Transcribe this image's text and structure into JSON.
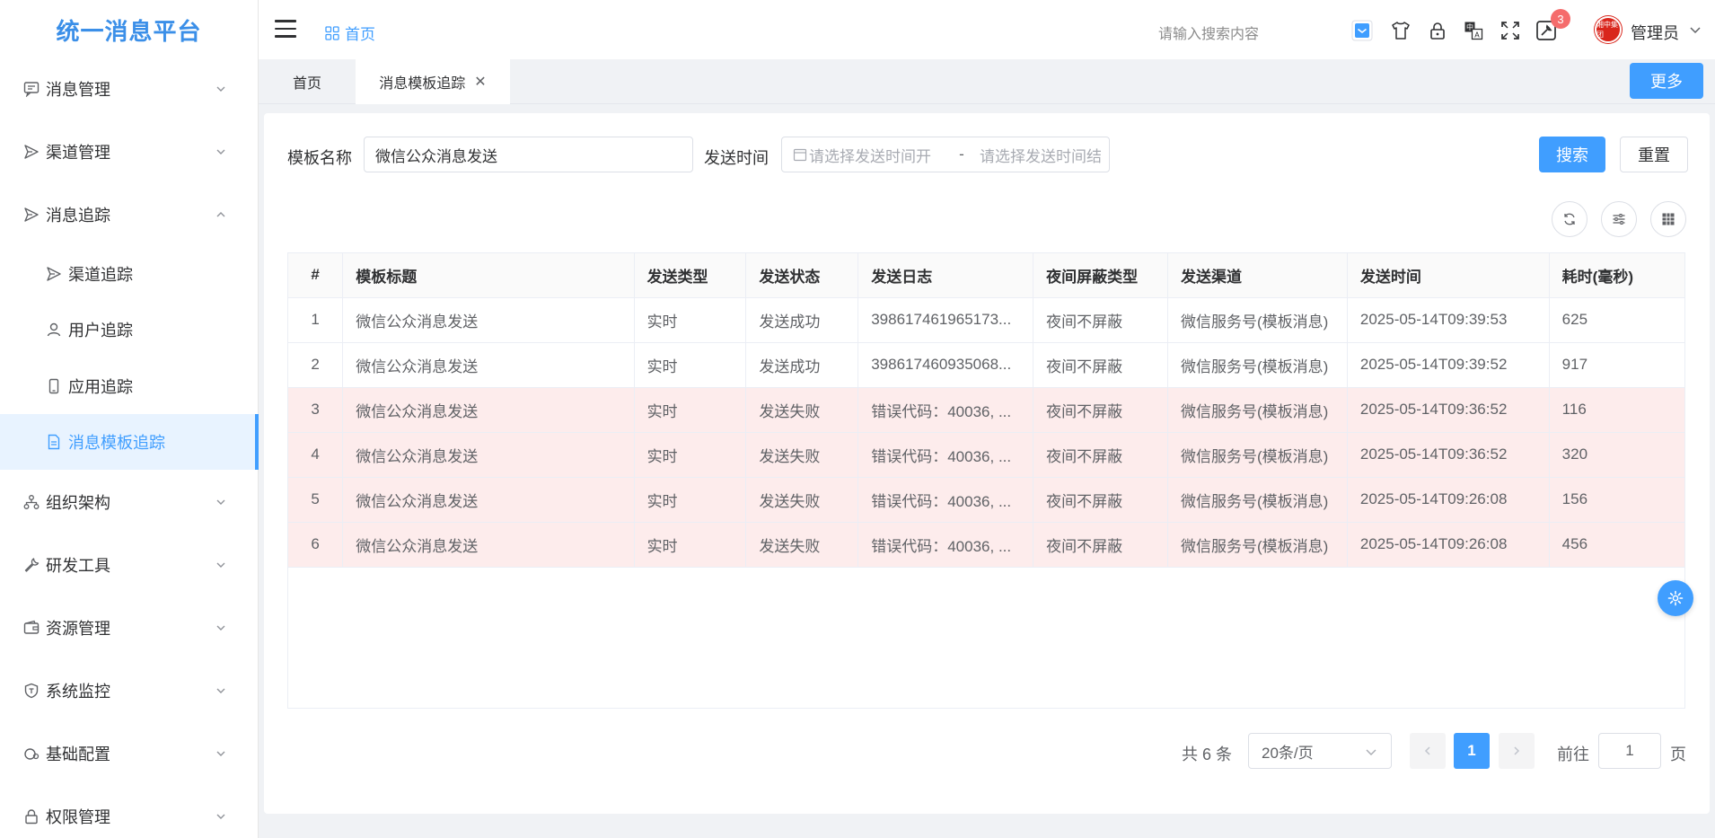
{
  "app": {
    "title": "统一消息平台"
  },
  "header": {
    "home_label": "首页",
    "search_placeholder": "请输入搜索内容",
    "notification_count": "3",
    "avatar_text": "湘中集团",
    "user_name": "管理员"
  },
  "sidebar": {
    "items": [
      {
        "label": "消息管理",
        "icon": "message-icon"
      },
      {
        "label": "渠道管理",
        "icon": "send-icon"
      },
      {
        "label": "消息追踪",
        "icon": "send-icon"
      },
      {
        "label": "渠道追踪",
        "icon": "send-icon"
      },
      {
        "label": "用户追踪",
        "icon": "user-icon"
      },
      {
        "label": "应用追踪",
        "icon": "mobile-icon"
      },
      {
        "label": "消息模板追踪",
        "icon": "document-icon"
      },
      {
        "label": "组织架构",
        "icon": "org-icon"
      },
      {
        "label": "研发工具",
        "icon": "wrench-icon"
      },
      {
        "label": "资源管理",
        "icon": "wallet-icon"
      },
      {
        "label": "系统监控",
        "icon": "shield-icon"
      },
      {
        "label": "基础配置",
        "icon": "config-icon"
      },
      {
        "label": "权限管理",
        "icon": "lock-icon"
      }
    ]
  },
  "tabs": [
    {
      "label": "首页"
    },
    {
      "label": "消息模板追踪"
    }
  ],
  "more_label": "更多",
  "filters": {
    "template_name_label": "模板名称",
    "template_name_value": "微信公众消息发送",
    "send_time_label": "发送时间",
    "start_placeholder": "请选择发送时间开",
    "range_separator": "-",
    "end_placeholder": "请选择发送时间结",
    "search_label": "搜索",
    "reset_label": "重置"
  },
  "table": {
    "columns": [
      "#",
      "模板标题",
      "发送类型",
      "发送状态",
      "发送日志",
      "夜间屏蔽类型",
      "发送渠道",
      "发送时间",
      "耗时(毫秒)"
    ],
    "rows": [
      {
        "idx": "1",
        "title": "微信公众消息发送",
        "type": "实时",
        "status": "发送成功",
        "log": "398617461965173...",
        "night": "夜间不屏蔽",
        "channel": "微信服务号(模板消息)",
        "time": "2025-05-14T09:39:53",
        "cost": "625",
        "failed": false
      },
      {
        "idx": "2",
        "title": "微信公众消息发送",
        "type": "实时",
        "status": "发送成功",
        "log": "398617460935068...",
        "night": "夜间不屏蔽",
        "channel": "微信服务号(模板消息)",
        "time": "2025-05-14T09:39:52",
        "cost": "917",
        "failed": false
      },
      {
        "idx": "3",
        "title": "微信公众消息发送",
        "type": "实时",
        "status": "发送失败",
        "log": "错误代码：40036, ...",
        "night": "夜间不屏蔽",
        "channel": "微信服务号(模板消息)",
        "time": "2025-05-14T09:36:52",
        "cost": "116",
        "failed": true
      },
      {
        "idx": "4",
        "title": "微信公众消息发送",
        "type": "实时",
        "status": "发送失败",
        "log": "错误代码：40036, ...",
        "night": "夜间不屏蔽",
        "channel": "微信服务号(模板消息)",
        "time": "2025-05-14T09:36:52",
        "cost": "320",
        "failed": true
      },
      {
        "idx": "5",
        "title": "微信公众消息发送",
        "type": "实时",
        "status": "发送失败",
        "log": "错误代码：40036, ...",
        "night": "夜间不屏蔽",
        "channel": "微信服务号(模板消息)",
        "time": "2025-05-14T09:26:08",
        "cost": "156",
        "failed": true
      },
      {
        "idx": "6",
        "title": "微信公众消息发送",
        "type": "实时",
        "status": "发送失败",
        "log": "错误代码：40036, ...",
        "night": "夜间不屏蔽",
        "channel": "微信服务号(模板消息)",
        "time": "2025-05-14T09:26:08",
        "cost": "456",
        "failed": true
      }
    ]
  },
  "pagination": {
    "total_text": "共 6 条",
    "page_size": "20条/页",
    "current_page": "1",
    "goto_label": "前往",
    "goto_value": "1",
    "page_suffix": "页"
  },
  "colors": {
    "primary": "#409eff",
    "fail_row": "#fdecec",
    "badge": "#f56c6c"
  }
}
